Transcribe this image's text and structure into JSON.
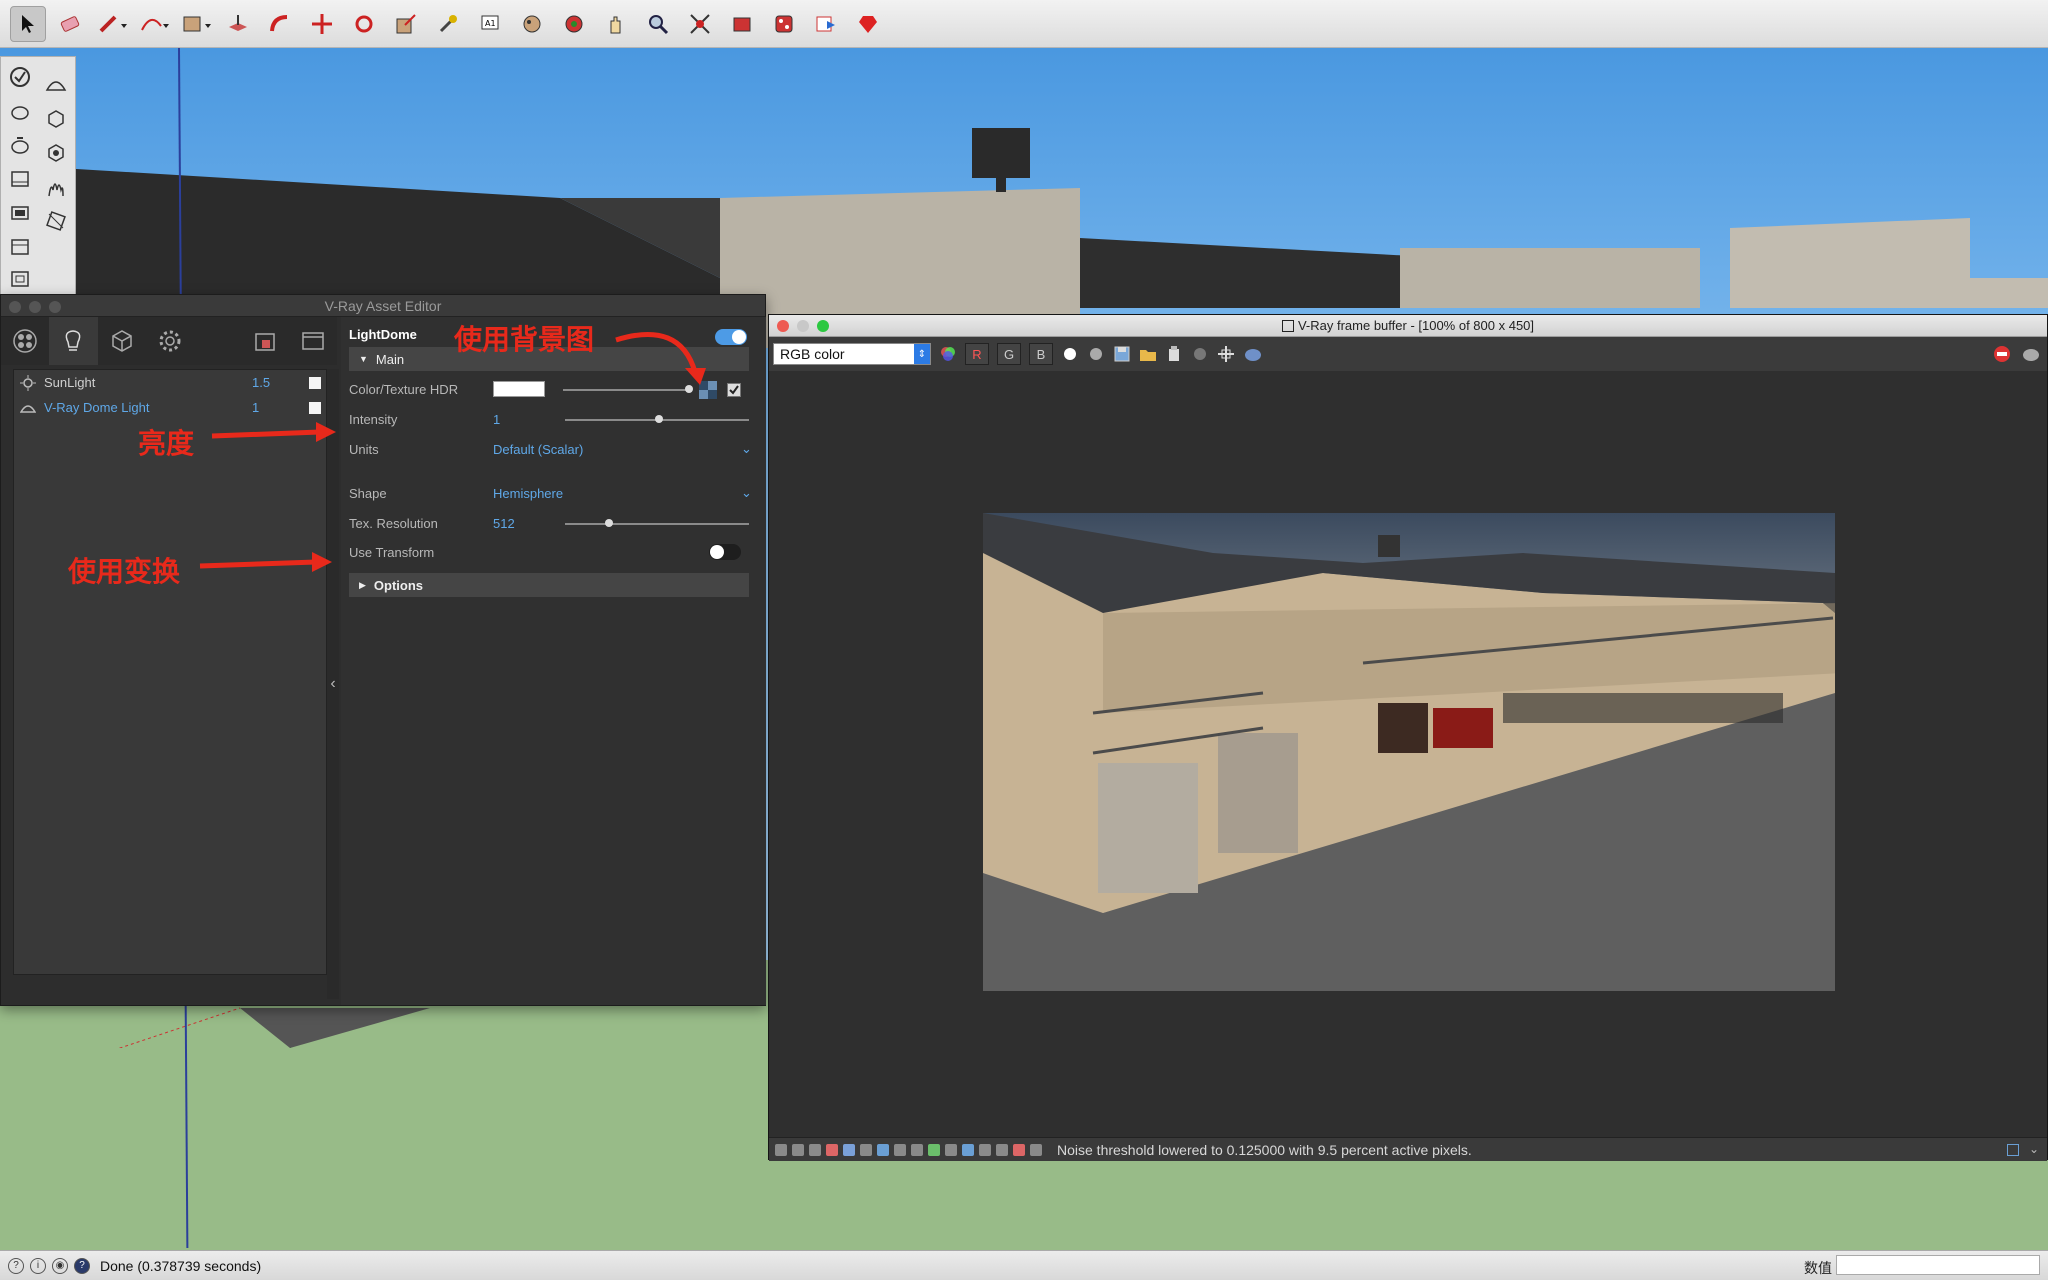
{
  "asset_editor": {
    "title": "V-Ray Asset Editor",
    "lights": [
      {
        "name": "SunLight",
        "value": "1.5",
        "selected": false
      },
      {
        "name": "V-Ray Dome Light",
        "value": "1",
        "selected": true
      }
    ],
    "props": {
      "header": "LightDome",
      "main_section": "Main",
      "color_label": "Color/Texture HDR",
      "intensity_label": "Intensity",
      "intensity_value": "1",
      "units_label": "Units",
      "units_value": "Default (Scalar)",
      "shape_label": "Shape",
      "shape_value": "Hemisphere",
      "texres_label": "Tex. Resolution",
      "texres_value": "512",
      "transform_label": "Use Transform",
      "options_section": "Options"
    }
  },
  "annotations": {
    "background": "使用背景图",
    "intensity": "亮度",
    "transform": "使用变换"
  },
  "vfb": {
    "title": "V-Ray frame buffer - [100% of 800 x 450]",
    "channel": "RGB color",
    "ch_r": "R",
    "ch_g": "G",
    "ch_b": "B",
    "status": "Noise threshold lowered to 0.125000 with 9.5 percent active pixels."
  },
  "statusbar": {
    "text": "Done (0.378739 seconds)",
    "measure_label": "数值"
  },
  "colors": {
    "accent": "#5fa8e8",
    "annotation": "#e8291b",
    "toggle_on": "#4d9be6"
  }
}
